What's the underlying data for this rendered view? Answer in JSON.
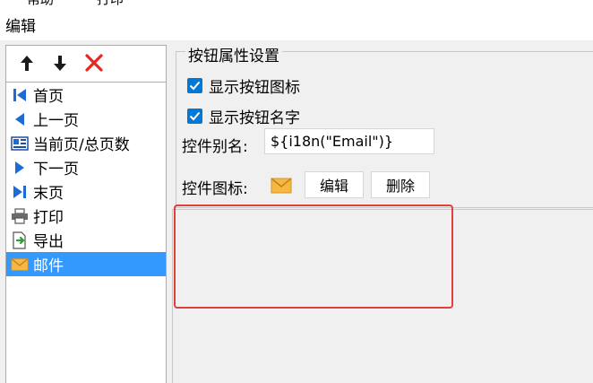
{
  "menu_fragment": {
    "item1": "帮助",
    "item2": "打印"
  },
  "window": {
    "title": "编辑"
  },
  "toolbar": {
    "up_icon": "arrow-up-icon",
    "down_icon": "arrow-down-icon",
    "delete_icon": "delete-x-icon"
  },
  "list": {
    "items": [
      {
        "label": "首页",
        "icon": "first-page-icon"
      },
      {
        "label": "上一页",
        "icon": "previous-page-icon"
      },
      {
        "label": "当前页/总页数",
        "icon": "page-count-icon"
      },
      {
        "label": "下一页",
        "icon": "next-page-icon"
      },
      {
        "label": "末页",
        "icon": "last-page-icon"
      },
      {
        "label": "打印",
        "icon": "printer-icon"
      },
      {
        "label": "导出",
        "icon": "export-icon"
      },
      {
        "label": "邮件",
        "icon": "mail-icon"
      }
    ],
    "selected_index": 7
  },
  "properties": {
    "group_title": "按钮属性设置",
    "show_icon_label": "显示按钮图标",
    "show_icon_checked": true,
    "show_name_label": "显示按钮名字",
    "show_name_checked": true,
    "alias_label": "控件别名:",
    "alias_value": "${i18n(\"Email\")}",
    "icon_label": "控件图标:",
    "edit_button": "编辑",
    "delete_button": "删除"
  },
  "colors": {
    "selection": "#3399ff",
    "checkbox": "#0078d7",
    "delete_x": "#e8281e",
    "highlight": "#e0403a",
    "mail": "#f5b942"
  }
}
